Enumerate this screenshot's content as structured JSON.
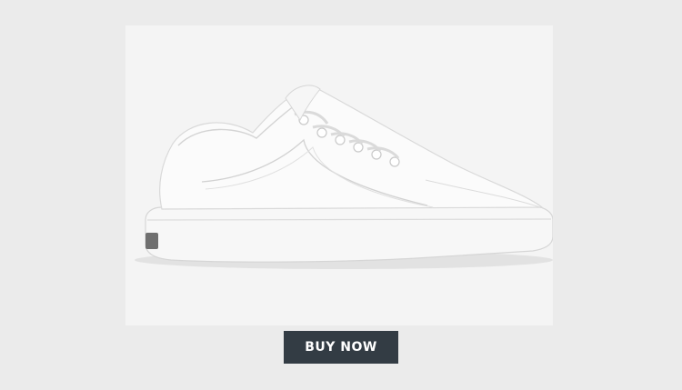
{
  "product": {
    "image_name": "white-low-top-canvas-sneaker"
  },
  "cta": {
    "label": "BUY NOW",
    "color": "#333c44"
  }
}
